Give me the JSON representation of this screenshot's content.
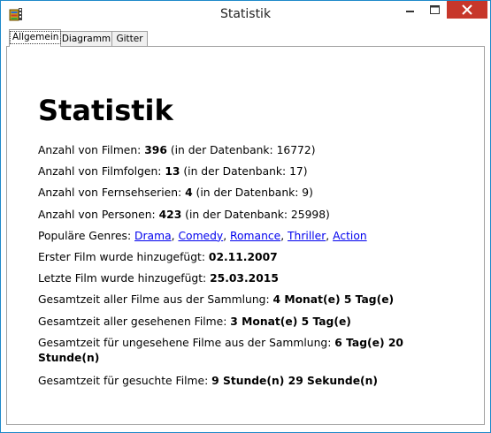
{
  "window": {
    "title": "Statistik",
    "icon": "film-app-icon",
    "controls": [
      "minimize-icon",
      "maximize-icon",
      "close-icon"
    ],
    "close_color": "#c7372b"
  },
  "tabs": [
    {
      "label": "Allgemein",
      "active": true
    },
    {
      "label": "Diagramm",
      "active": false
    },
    {
      "label": "Gitter",
      "active": false
    }
  ],
  "heading": "Statistik",
  "stats": {
    "films": {
      "label": "Anzahl von Filmen:",
      "value": "396",
      "db_text": "(in der Datenbank: 16772)"
    },
    "episodes": {
      "label": "Anzahl von Filmfolgen:",
      "value": "13",
      "db_text": "(in der Datenbank: 17)"
    },
    "series": {
      "label": "Anzahl von Fernsehserien:",
      "value": "4",
      "db_text": "(in der Datenbank: 9)"
    },
    "persons": {
      "label": "Anzahl von Personen:",
      "value": "423",
      "db_text": "(in der Datenbank: 25998)"
    },
    "genres": {
      "label": "Populäre Genres:",
      "items": [
        "Drama",
        "Comedy",
        "Romance",
        "Thriller",
        "Action"
      ],
      "sep": ","
    },
    "first_added": {
      "label": "Erster Film wurde hinzugefügt:",
      "value": "02.11.2007"
    },
    "last_added": {
      "label": "Letzte Film wurde hinzugefügt:",
      "value": "25.03.2015"
    },
    "total_time": {
      "label": "Gesamtzeit aller Filme aus der Sammlung:",
      "value": "4 Monat(e) 5 Tag(e)"
    },
    "watched_time": {
      "label": "Gesamtzeit aller gesehenen Filme:",
      "value": "3 Monat(e) 5 Tag(e)"
    },
    "unwatched_time": {
      "label": "Gesamtzeit für ungesehene Filme aus der Sammlung:",
      "value": "6 Tag(e) 20 Stunde(n)"
    },
    "wanted_time": {
      "label": "Gesamtzeit für gesuchte Filme:",
      "value": "9 Stunde(n) 29 Sekunde(n)"
    }
  },
  "colors": {
    "link": "#0000ee",
    "border": "#1e89c9"
  }
}
